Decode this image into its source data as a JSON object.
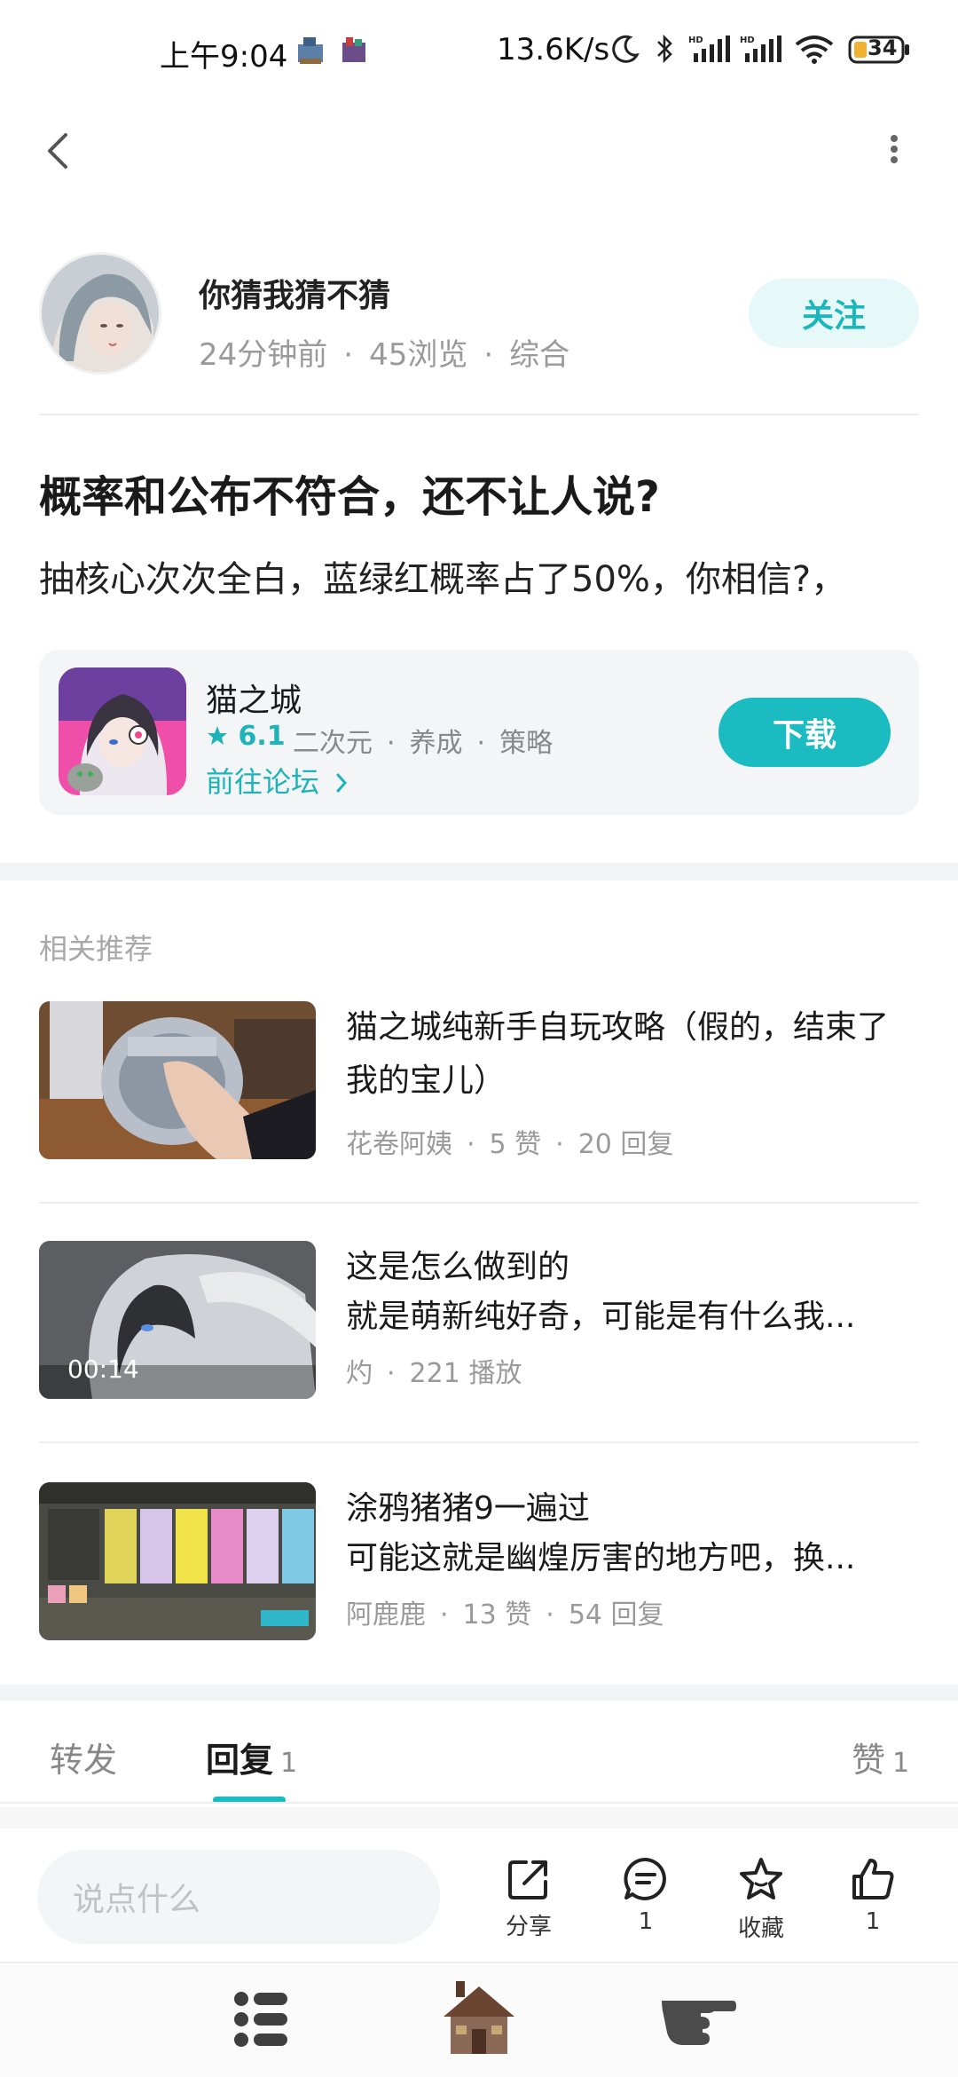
{
  "status_bar": {
    "time": "上午9:04",
    "net_speed": "13.6K/s",
    "battery": "34"
  },
  "author": {
    "name": "你猜我猜不猜",
    "time_ago": "24分钟前",
    "views": "45浏览",
    "category": "综合",
    "follow_label": "关注"
  },
  "post": {
    "title": "概率和公布不符合，还不让人说?",
    "body": "抽核心次次全白，蓝绿红概率占了50%，你相信?，"
  },
  "game": {
    "name": "猫之城",
    "rating": "6.1",
    "tags": [
      "二次元",
      "养成",
      "策略"
    ],
    "forum_link": "前往论坛",
    "download_label": "下载"
  },
  "recommend": {
    "heading": "相关推荐",
    "items": [
      {
        "title_line1": "猫之城纯新手自玩攻略（假的，结束了",
        "title_line2": "我的宝儿）",
        "author": "花卷阿姨",
        "stat1": "5 赞",
        "stat2": "20 回复"
      },
      {
        "title_line1": "这是怎么做到的",
        "title_line2": "就是萌新纯好奇，可能是有什么我...",
        "author": "灼",
        "stat1": "221 播放",
        "duration": "00:14"
      },
      {
        "title_line1": "涂鸦猪猪9一遍过",
        "title_line2": "可能这就是幽煌厉害的地方吧，换...",
        "author": "阿鹿鹿",
        "stat1": "13 赞",
        "stat2": "54 回复"
      }
    ]
  },
  "tabs": {
    "repost": "转发",
    "reply": "回复",
    "reply_count": "1",
    "like": "赞",
    "like_count": "1"
  },
  "action_bar": {
    "input_placeholder": "说点什么",
    "share_label": "分享",
    "comment_count": "1",
    "collect_label": "收藏",
    "like_count": "1"
  },
  "colors": {
    "accent": "#1bbcc1",
    "follow_bg": "#e7f8f8",
    "card_bg": "#f4f5f6"
  }
}
